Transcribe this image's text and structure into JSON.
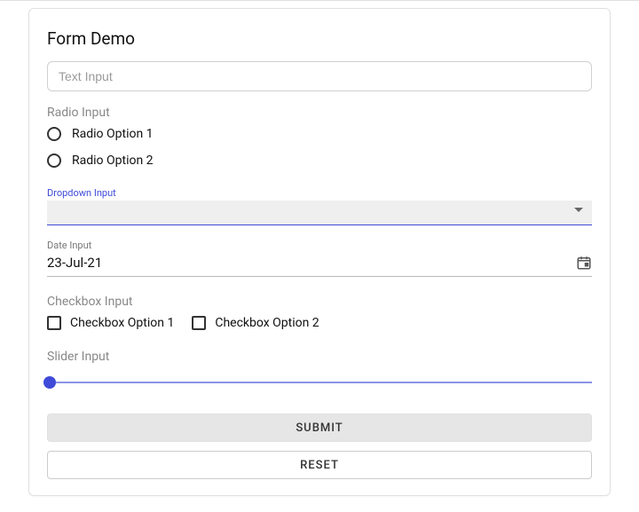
{
  "title": "Form Demo",
  "text_input": {
    "placeholder": "Text Input",
    "value": ""
  },
  "radio": {
    "label": "Radio Input",
    "options": [
      "Radio Option 1",
      "Radio Option 2"
    ]
  },
  "dropdown": {
    "label": "Dropdown Input",
    "value": ""
  },
  "date": {
    "label": "Date Input",
    "value": "23-Jul-21"
  },
  "checkbox": {
    "label": "Checkbox Input",
    "options": [
      "Checkbox Option 1",
      "Checkbox Option 2"
    ]
  },
  "slider": {
    "label": "Slider Input",
    "position": 0
  },
  "buttons": {
    "submit": "SUBMIT",
    "reset": "RESET"
  }
}
